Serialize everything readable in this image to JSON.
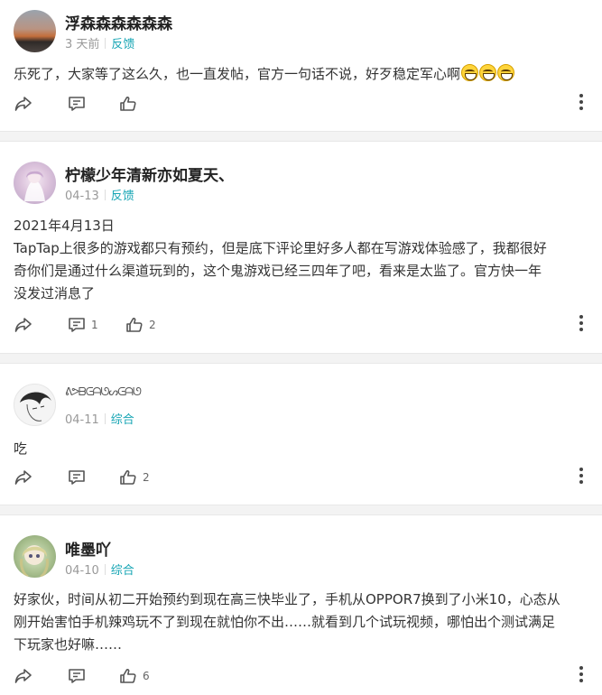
{
  "posts": [
    {
      "username": "浮森森森森森森",
      "time": "3 天前",
      "tag": "反馈",
      "content_lines": [
        "乐死了，大家等了这么久，也一直发帖，官方一句话不说，好歹稳定军心啊"
      ],
      "emoji_count": 3,
      "comment_count": "",
      "like_count": ""
    },
    {
      "username": "柠檬少年清新亦如夏天、",
      "time": "04-13",
      "tag": "反馈",
      "content_lines": [
        "2021年4月13日",
        "TapTap上很多的游戏都只有预约，但是底下评论里好多人都在写游戏体验感了，我都很好",
        "奇你们是通过什么渠道玩到的，这个鬼游戏已经三四年了吧，看来是太监了。官方快一年",
        "没发过消息了"
      ],
      "comment_count": "1",
      "like_count": "2"
    },
    {
      "username": "ᕕᕗᗷᕮᗩᘎᔕᕮᗩᘎ",
      "time": "04-11",
      "tag": "综合",
      "content_lines": [
        "吃"
      ],
      "comment_count": "",
      "like_count": "2"
    },
    {
      "username": "唯墨吖",
      "time": "04-10",
      "tag": "综合",
      "content_lines": [
        "好家伙，时间从初二开始预约到现在高三快毕业了，手机从OPPOR7换到了小米10，心态从",
        "刚开始害怕手机辣鸡玩不了到现在就怕你不出……就看到几个试玩视频，哪怕出个测试满足",
        "下玩家也好嘛……"
      ],
      "comment_count": "",
      "like_count": "6"
    }
  ],
  "icons": {
    "share": "share-icon",
    "comment": "comment-icon",
    "like": "thumbs-up-icon",
    "more": "more-vertical-icon"
  },
  "colors": {
    "tag": "#16a5b4",
    "meta": "#999999",
    "separator": "#f3f3f3"
  }
}
